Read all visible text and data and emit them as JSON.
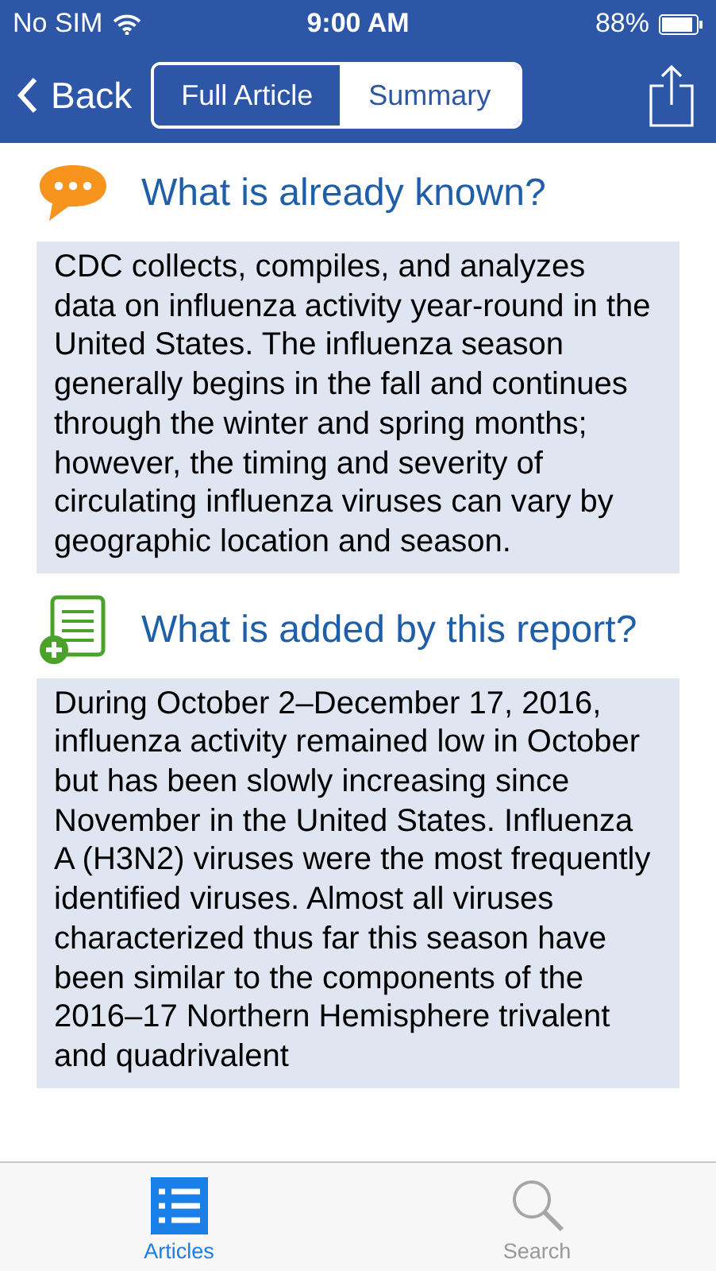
{
  "status_bar": {
    "carrier": "No SIM",
    "time": "9:00 AM",
    "battery": "88%"
  },
  "nav_bar": {
    "back": "Back",
    "segments": [
      {
        "label": "Full Article",
        "selected": false
      },
      {
        "label": "Summary",
        "selected": true
      }
    ]
  },
  "sections": [
    {
      "kind": "known",
      "heading": "What is already known?",
      "text": "CDC collects, compiles, and analyzes data on influenza activity year-round in the United States. The influenza season generally begins in the fall and continues through the winter and spring months; however, the timing and severity of circulating influenza viruses can vary by geographic location and season."
    },
    {
      "kind": "added",
      "heading": "What is added by this report?",
      "text": "During October 2–December 17, 2016, influenza activity remained low in October but has been slowly increasing since November in the United States. Influenza A (H3N2) viruses were the most frequently identified viruses. Almost all viruses characterized thus far this season have been similar to the components of the 2016–17 Northern Hemisphere trivalent and quadrivalent"
    }
  ],
  "tab_bar": [
    {
      "kind": "articles",
      "label": "Articles",
      "selected": true
    },
    {
      "kind": "search",
      "label": "Search",
      "selected": false
    }
  ]
}
